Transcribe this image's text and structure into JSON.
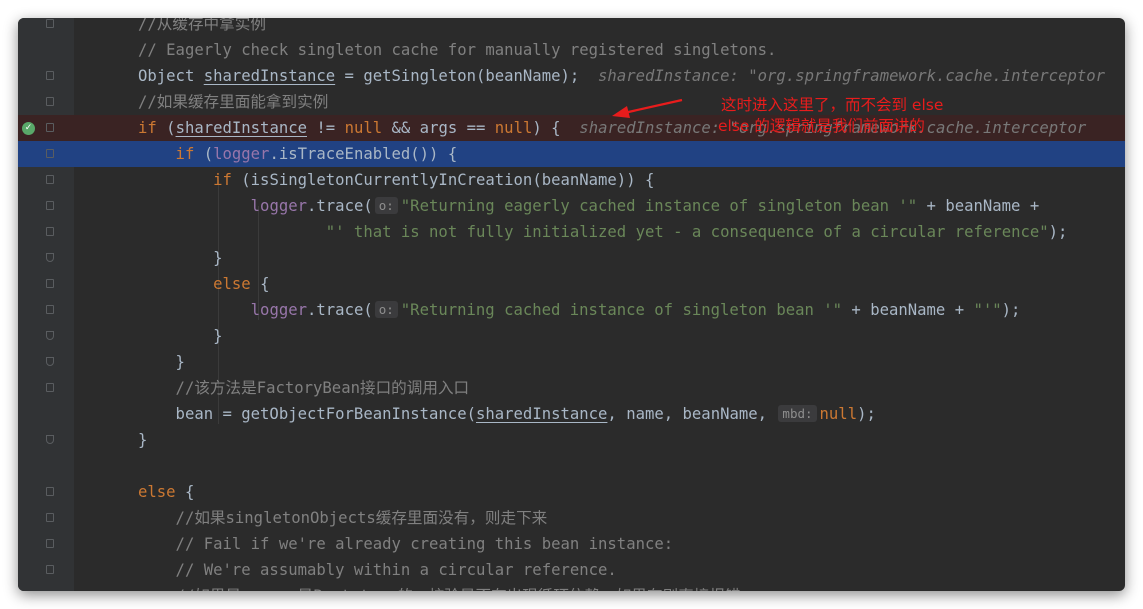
{
  "editor": {
    "lines": [
      {
        "seg": [
          {
            "t": "//从缓存中拿实例",
            "c": "cmt"
          }
        ]
      },
      {
        "seg": [
          {
            "t": "// Eagerly check singleton cache for manually registered singletons.",
            "c": "cmt"
          }
        ]
      },
      {
        "seg": [
          {
            "t": "Object ",
            "c": ""
          },
          {
            "t": "sharedInstance",
            "c": "ul"
          },
          {
            "t": " = getSingleton(beanName);",
            "c": ""
          },
          {
            "t": "  sharedInstance: \"org.springframework.cache.interceptor",
            "c": "hint"
          }
        ]
      },
      {
        "seg": [
          {
            "t": "//如果缓存里面能拿到实例",
            "c": "cmt"
          }
        ]
      },
      {
        "seg": [
          {
            "t": "if ",
            "c": "kw"
          },
          {
            "t": "(",
            "c": ""
          },
          {
            "t": "sharedInstance",
            "c": "ul"
          },
          {
            "t": " != ",
            "c": ""
          },
          {
            "t": "null",
            "c": "kw"
          },
          {
            "t": " && args == ",
            "c": ""
          },
          {
            "t": "null",
            "c": "kw"
          },
          {
            "t": ") {",
            "c": ""
          },
          {
            "t": "  sharedInstance: \"org.springframework.cache.interceptor",
            "c": "hint"
          }
        ]
      },
      {
        "seg": [
          {
            "t": "    if ",
            "c": "kw"
          },
          {
            "t": "(",
            "c": ""
          },
          {
            "t": "logger",
            "c": "fld"
          },
          {
            "t": ".isTraceEnabled()) {",
            "c": ""
          }
        ]
      },
      {
        "seg": [
          {
            "t": "        if ",
            "c": "kw"
          },
          {
            "t": "(isSingletonCurrentlyInCreation(beanName)) {",
            "c": ""
          }
        ]
      },
      {
        "seg": [
          {
            "t": "            ",
            "c": ""
          },
          {
            "t": "logger",
            "c": "fld"
          },
          {
            "t": ".trace(",
            "c": ""
          },
          {
            "t": "o:",
            "c": "pn"
          },
          {
            "t": "\"Returning eagerly cached instance of singleton bean '\"",
            "c": "str"
          },
          {
            "t": " + beanName +",
            "c": ""
          }
        ]
      },
      {
        "seg": [
          {
            "t": "                    ",
            "c": ""
          },
          {
            "t": "\"' that is not fully initialized yet - a consequence of a circular reference\"",
            "c": "str"
          },
          {
            "t": ");",
            "c": ""
          }
        ]
      },
      {
        "seg": [
          {
            "t": "        }",
            "c": ""
          }
        ]
      },
      {
        "seg": [
          {
            "t": "        else ",
            "c": "kw"
          },
          {
            "t": "{",
            "c": ""
          }
        ]
      },
      {
        "seg": [
          {
            "t": "            ",
            "c": ""
          },
          {
            "t": "logger",
            "c": "fld"
          },
          {
            "t": ".trace(",
            "c": ""
          },
          {
            "t": "o:",
            "c": "pn"
          },
          {
            "t": "\"Returning cached instance of singleton bean '\"",
            "c": "str"
          },
          {
            "t": " + beanName + ",
            "c": ""
          },
          {
            "t": "\"'\"",
            "c": "str"
          },
          {
            "t": ");",
            "c": ""
          }
        ]
      },
      {
        "seg": [
          {
            "t": "        }",
            "c": ""
          }
        ]
      },
      {
        "seg": [
          {
            "t": "    }",
            "c": ""
          }
        ]
      },
      {
        "seg": [
          {
            "t": "    //该方法是FactoryBean接口的调用入口",
            "c": "cmt"
          }
        ]
      },
      {
        "seg": [
          {
            "t": "    bean = getObjectForBeanInstance(",
            "c": ""
          },
          {
            "t": "sharedInstance",
            "c": "ul"
          },
          {
            "t": ", name, beanName, ",
            "c": ""
          },
          {
            "t": "mbd:",
            "c": "pn"
          },
          {
            "t": "null",
            "c": "kw"
          },
          {
            "t": ");",
            "c": ""
          }
        ]
      },
      {
        "seg": [
          {
            "t": "}",
            "c": ""
          }
        ]
      },
      {
        "seg": []
      },
      {
        "seg": [
          {
            "t": "else ",
            "c": "kw"
          },
          {
            "t": "{",
            "c": ""
          }
        ]
      },
      {
        "seg": [
          {
            "t": "    //如果singletonObjects缓存里面没有，则走下来",
            "c": "cmt"
          }
        ]
      },
      {
        "seg": [
          {
            "t": "    // Fail if we're already creating this bean instance:",
            "c": "cmt"
          }
        ]
      },
      {
        "seg": [
          {
            "t": "    // We're assumably within a circular reference.",
            "c": "cmt"
          }
        ]
      },
      {
        "seg": [
          {
            "t": "    //如果是scope 是Prototype的，校验是否有出现循环依赖，如果有则直接报错",
            "c": "cmt"
          }
        ]
      }
    ]
  },
  "annotation": {
    "line1": "这时进入这里了，而不会到 else",
    "line2": "else 的逻辑就是我们前面讲的",
    "color": "#e81c1c"
  },
  "colors": {
    "background": "#2b2b2b",
    "current_line": "#214283",
    "breakpoint_line": "#3a2323",
    "keyword": "#cc7832",
    "string": "#6a8759",
    "comment": "#808080",
    "field": "#9876aa"
  },
  "icons": {
    "breakpoint": "check-breakpoint-icon",
    "fold": "fold-marker-icon",
    "arrow": "red-arrow-icon"
  }
}
